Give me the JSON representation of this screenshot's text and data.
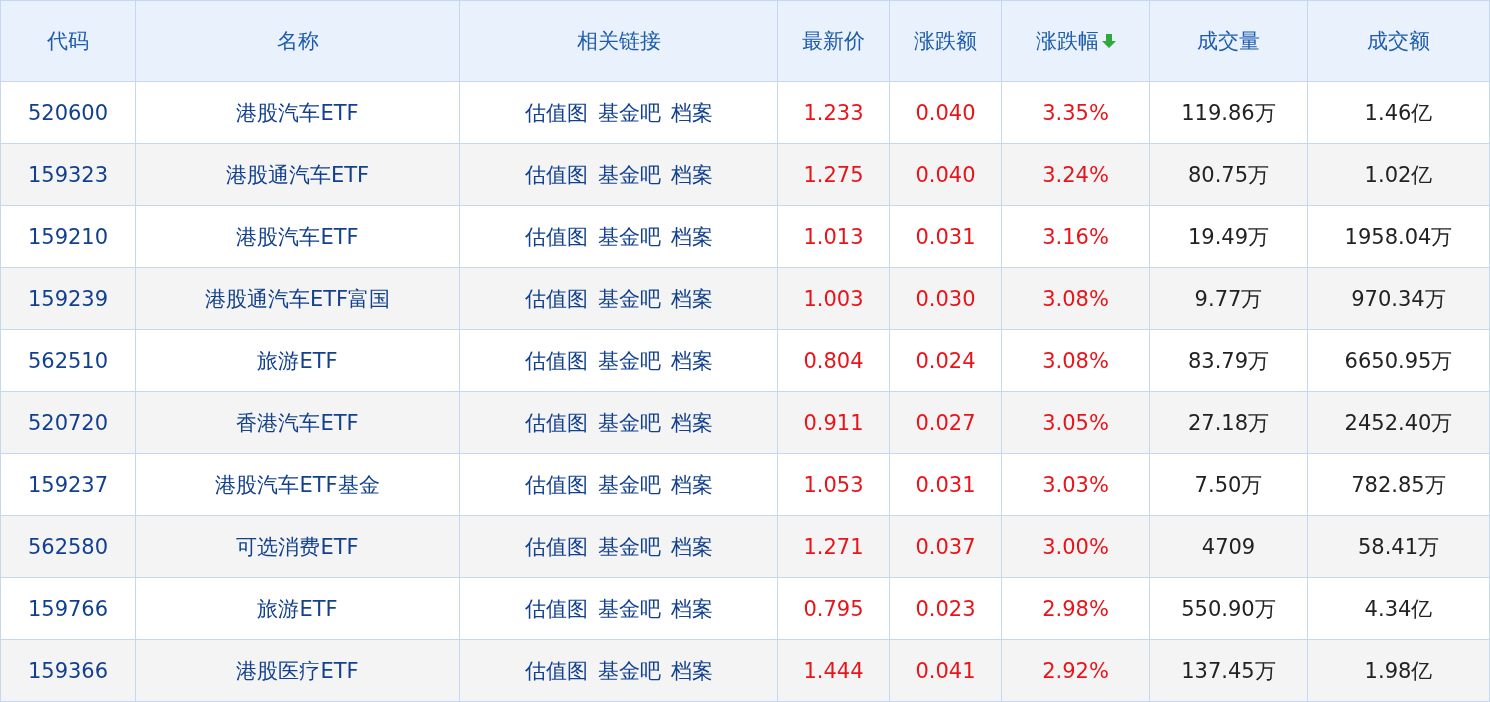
{
  "table": {
    "columns": [
      {
        "label": "代码",
        "sorted": false
      },
      {
        "label": "名称",
        "sorted": false
      },
      {
        "label": "相关链接",
        "sorted": false
      },
      {
        "label": "最新价",
        "sorted": false
      },
      {
        "label": "涨跌额",
        "sorted": false
      },
      {
        "label": "涨跌幅",
        "sorted": true
      },
      {
        "label": "成交量",
        "sorted": false
      },
      {
        "label": "成交额",
        "sorted": false
      }
    ],
    "rows": [
      {
        "code": "520600",
        "name": "港股汽车ETF",
        "links": [
          "估值图",
          "基金吧",
          "档案"
        ],
        "price": "1.233",
        "change": "0.040",
        "pct": "3.35%",
        "volume": "119.86万",
        "amount": "1.46亿"
      },
      {
        "code": "159323",
        "name": "港股通汽车ETF",
        "links": [
          "估值图",
          "基金吧",
          "档案"
        ],
        "price": "1.275",
        "change": "0.040",
        "pct": "3.24%",
        "volume": "80.75万",
        "amount": "1.02亿"
      },
      {
        "code": "159210",
        "name": "港股汽车ETF",
        "links": [
          "估值图",
          "基金吧",
          "档案"
        ],
        "price": "1.013",
        "change": "0.031",
        "pct": "3.16%",
        "volume": "19.49万",
        "amount": "1958.04万"
      },
      {
        "code": "159239",
        "name": "港股通汽车ETF富国",
        "links": [
          "估值图",
          "基金吧",
          "档案"
        ],
        "price": "1.003",
        "change": "0.030",
        "pct": "3.08%",
        "volume": "9.77万",
        "amount": "970.34万"
      },
      {
        "code": "562510",
        "name": "旅游ETF",
        "links": [
          "估值图",
          "基金吧",
          "档案"
        ],
        "price": "0.804",
        "change": "0.024",
        "pct": "3.08%",
        "volume": "83.79万",
        "amount": "6650.95万"
      },
      {
        "code": "520720",
        "name": "香港汽车ETF",
        "links": [
          "估值图",
          "基金吧",
          "档案"
        ],
        "price": "0.911",
        "change": "0.027",
        "pct": "3.05%",
        "volume": "27.18万",
        "amount": "2452.40万"
      },
      {
        "code": "159237",
        "name": "港股汽车ETF基金",
        "links": [
          "估值图",
          "基金吧",
          "档案"
        ],
        "price": "1.053",
        "change": "0.031",
        "pct": "3.03%",
        "volume": "7.50万",
        "amount": "782.85万"
      },
      {
        "code": "562580",
        "name": "可选消费ETF",
        "links": [
          "估值图",
          "基金吧",
          "档案"
        ],
        "price": "1.271",
        "change": "0.037",
        "pct": "3.00%",
        "volume": "4709",
        "amount": "58.41万"
      },
      {
        "code": "159766",
        "name": "旅游ETF",
        "links": [
          "估值图",
          "基金吧",
          "档案"
        ],
        "price": "0.795",
        "change": "0.023",
        "pct": "2.98%",
        "volume": "550.90万",
        "amount": "4.34亿"
      },
      {
        "code": "159366",
        "name": "港股医疗ETF",
        "links": [
          "估值图",
          "基金吧",
          "档案"
        ],
        "price": "1.444",
        "change": "0.041",
        "pct": "2.92%",
        "volume": "137.45万",
        "amount": "1.98亿"
      }
    ]
  }
}
